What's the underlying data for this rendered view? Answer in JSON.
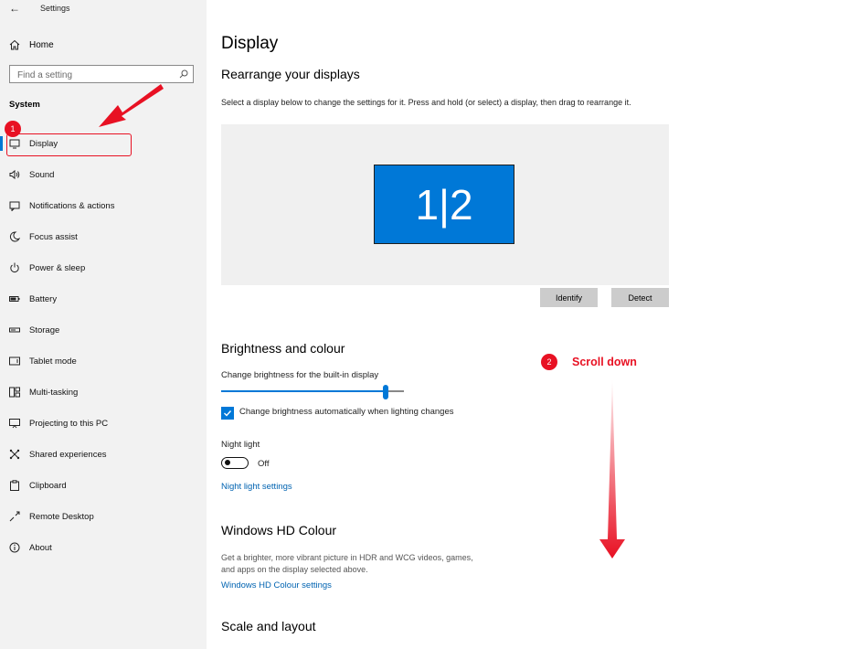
{
  "window": {
    "title": "Settings",
    "back_glyph": "←"
  },
  "sidebar": {
    "home_label": "Home",
    "search_placeholder": "Find a setting",
    "section_label": "System",
    "items": [
      {
        "label": "Display",
        "icon": "display-icon",
        "active": true
      },
      {
        "label": "Sound",
        "icon": "sound-icon"
      },
      {
        "label": "Notifications & actions",
        "icon": "notifications-icon"
      },
      {
        "label": "Focus assist",
        "icon": "focus-assist-icon"
      },
      {
        "label": "Power & sleep",
        "icon": "power-icon"
      },
      {
        "label": "Battery",
        "icon": "battery-icon"
      },
      {
        "label": "Storage",
        "icon": "storage-icon"
      },
      {
        "label": "Tablet mode",
        "icon": "tablet-mode-icon"
      },
      {
        "label": "Multi-tasking",
        "icon": "multitasking-icon"
      },
      {
        "label": "Projecting to this PC",
        "icon": "projecting-icon"
      },
      {
        "label": "Shared experiences",
        "icon": "shared-experiences-icon"
      },
      {
        "label": "Clipboard",
        "icon": "clipboard-icon"
      },
      {
        "label": "Remote Desktop",
        "icon": "remote-desktop-icon"
      },
      {
        "label": "About",
        "icon": "about-icon"
      }
    ]
  },
  "main": {
    "title": "Display",
    "rearrange": {
      "heading": "Rearrange your displays",
      "description": "Select a display below to change the settings for it. Press and hold (or select) a display, then drag to rearrange it.",
      "monitor_label": "1|2",
      "identify_label": "Identify",
      "detect_label": "Detect"
    },
    "brightness": {
      "heading": "Brightness and colour",
      "slider_label": "Change brightness for the built-in display",
      "slider_value_percent": 90,
      "auto_checkbox_label": "Change brightness automatically when lighting changes",
      "auto_checked": true,
      "night_light_label": "Night light",
      "night_light_state": "Off",
      "night_light_link": "Night light settings"
    },
    "hd_colour": {
      "heading": "Windows HD Colour",
      "description_line1": "Get a brighter, more vibrant picture in HDR and WCG videos, games,",
      "description_line2": "and apps on the display selected above.",
      "link": "Windows HD Colour settings"
    },
    "scale": {
      "heading": "Scale and layout"
    }
  },
  "annotations": {
    "step1_number": "1",
    "step2_number": "2",
    "step2_text": "Scroll down",
    "color": "#e81123"
  },
  "colors": {
    "accent": "#0078d7",
    "link": "#0063b1",
    "sidebar_bg": "#f2f2f2"
  }
}
